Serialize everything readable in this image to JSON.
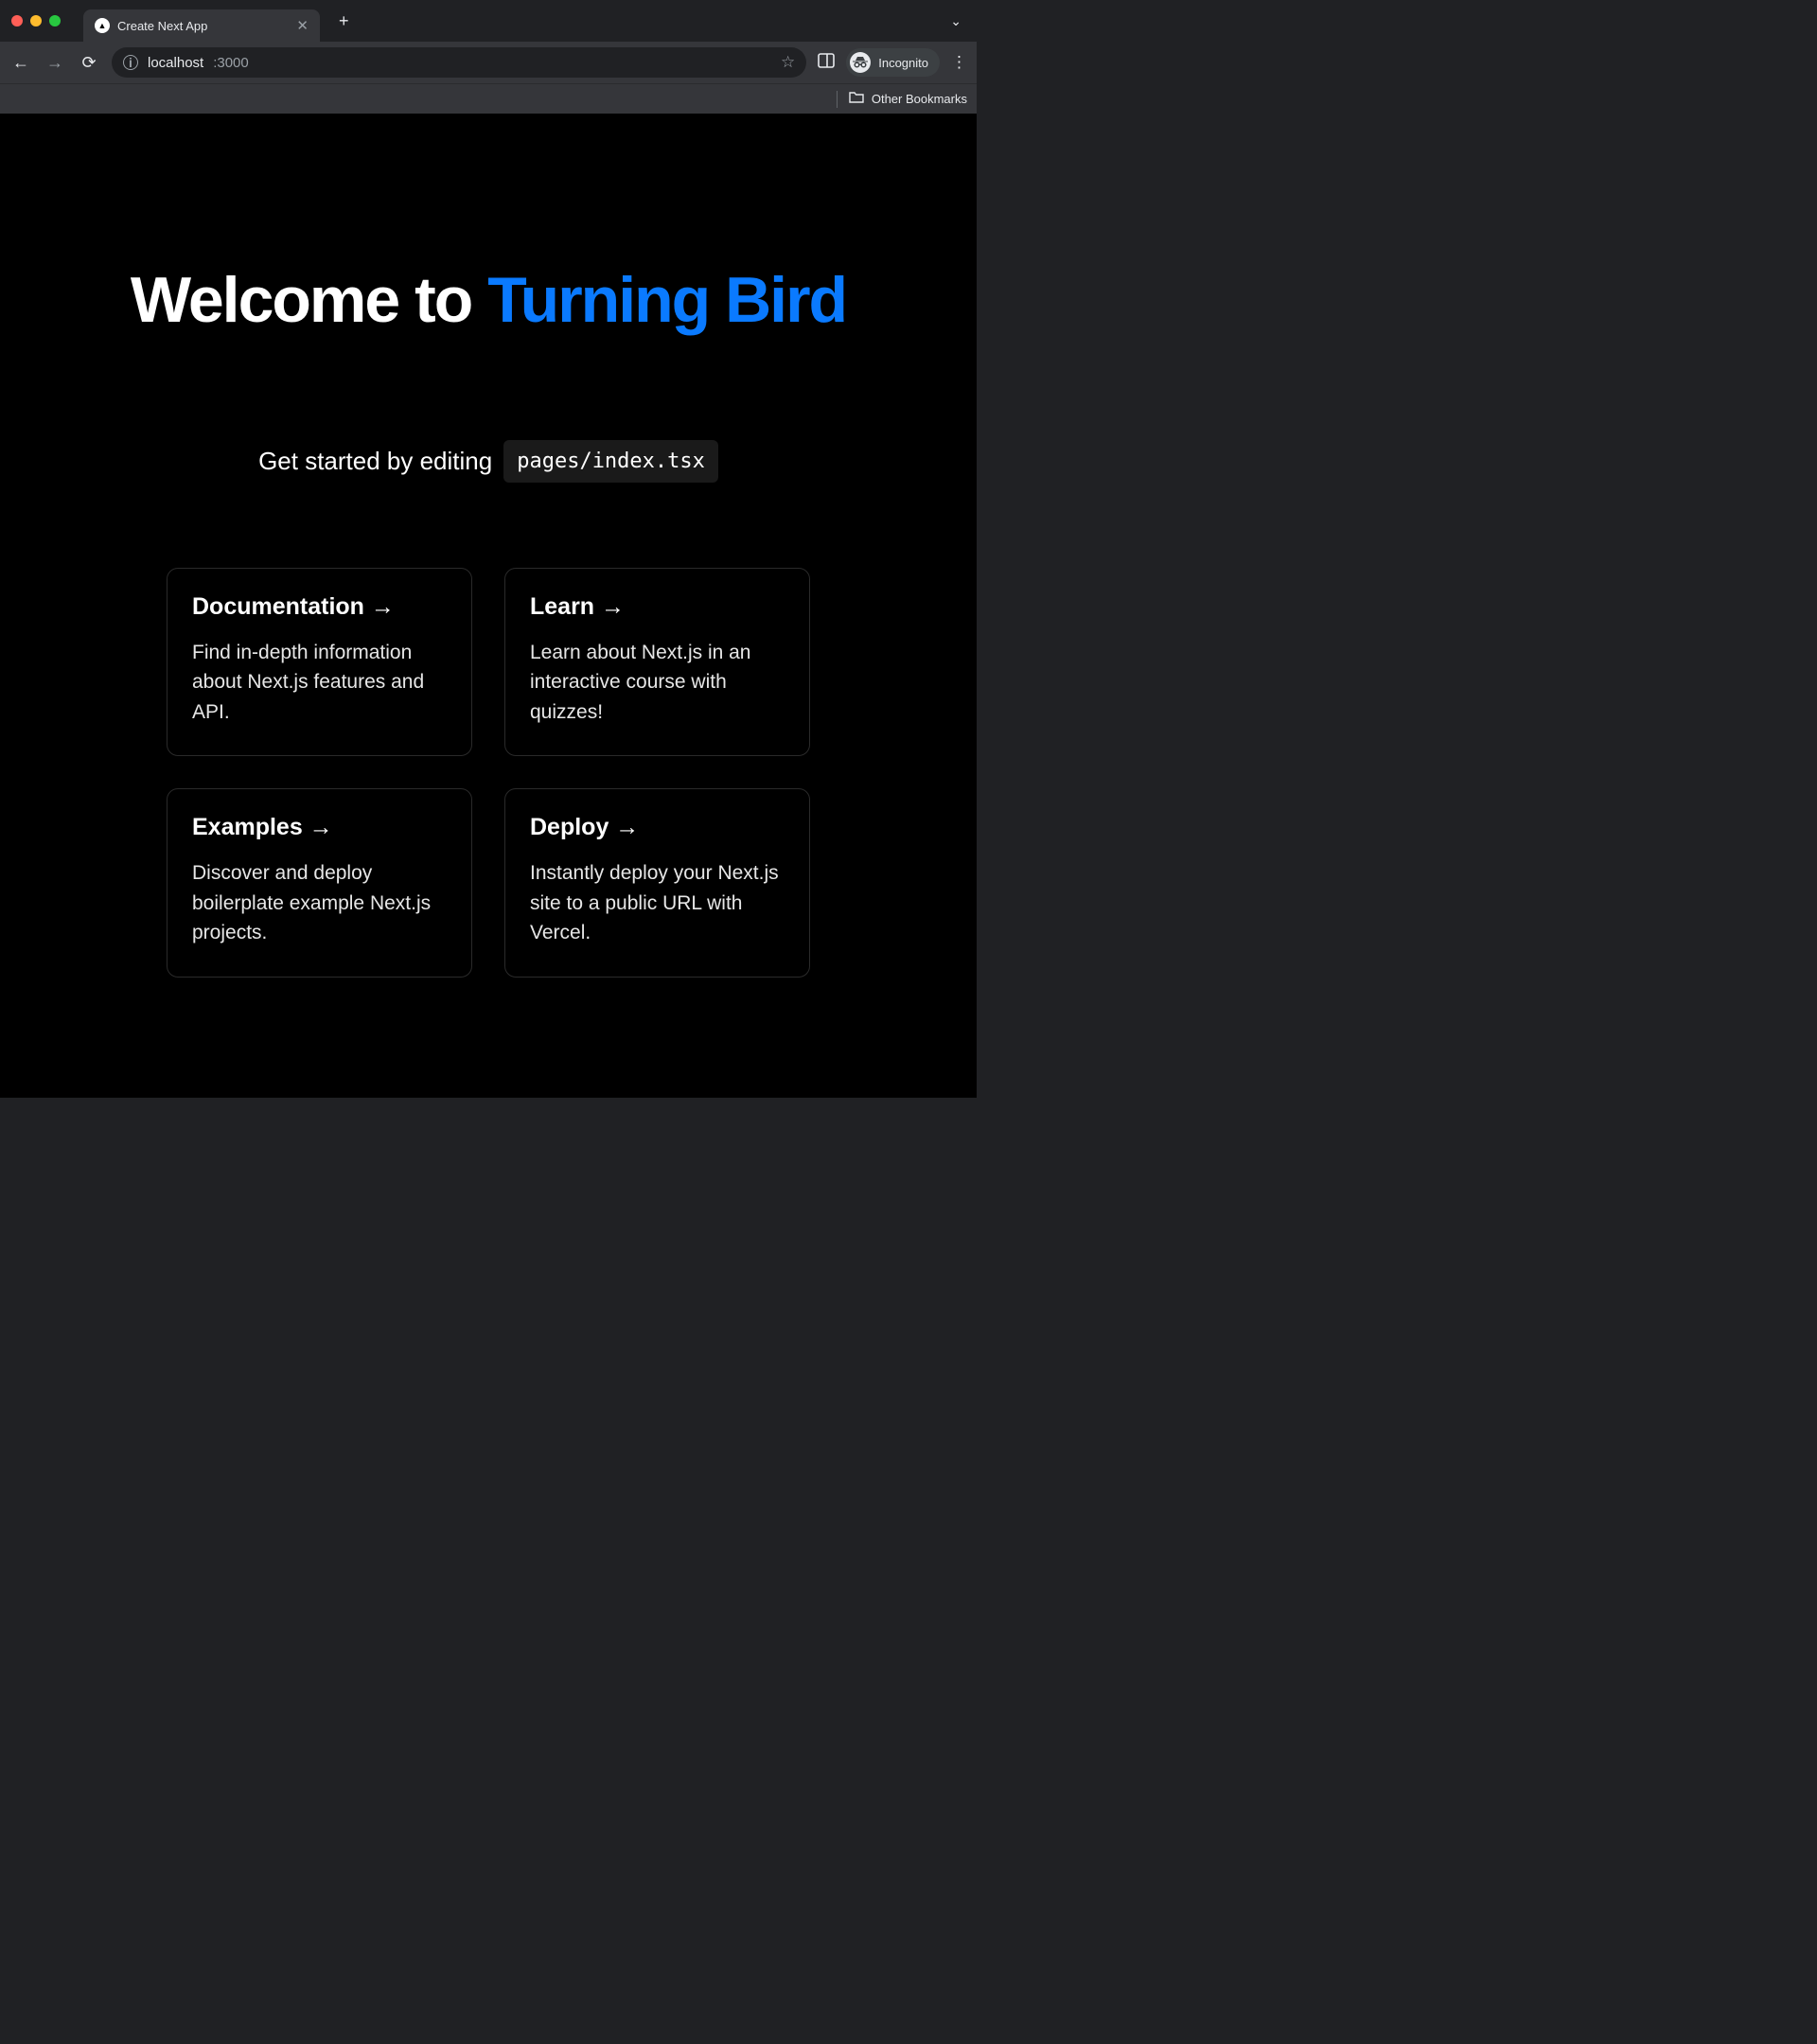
{
  "browser": {
    "tab": {
      "title": "Create Next App"
    },
    "url": {
      "host": "localhost",
      "port": ":3000"
    },
    "incognito_label": "Incognito",
    "bookmarks_label": "Other Bookmarks"
  },
  "page": {
    "hero_prefix": "Welcome to ",
    "hero_accent": "Turning Bird",
    "subtitle_prefix": "Get started by editing ",
    "subtitle_code": "pages/index.tsx",
    "cards": [
      {
        "title": "Documentation →",
        "desc": "Find in-depth information about Next.js features and API."
      },
      {
        "title": "Learn →",
        "desc": "Learn about Next.js in an interactive course with quizzes!"
      },
      {
        "title": "Examples →",
        "desc": "Discover and deploy boilerplate example Next.js projects."
      },
      {
        "title": "Deploy →",
        "desc": "Instantly deploy your Next.js site to a public URL with Vercel."
      }
    ]
  }
}
